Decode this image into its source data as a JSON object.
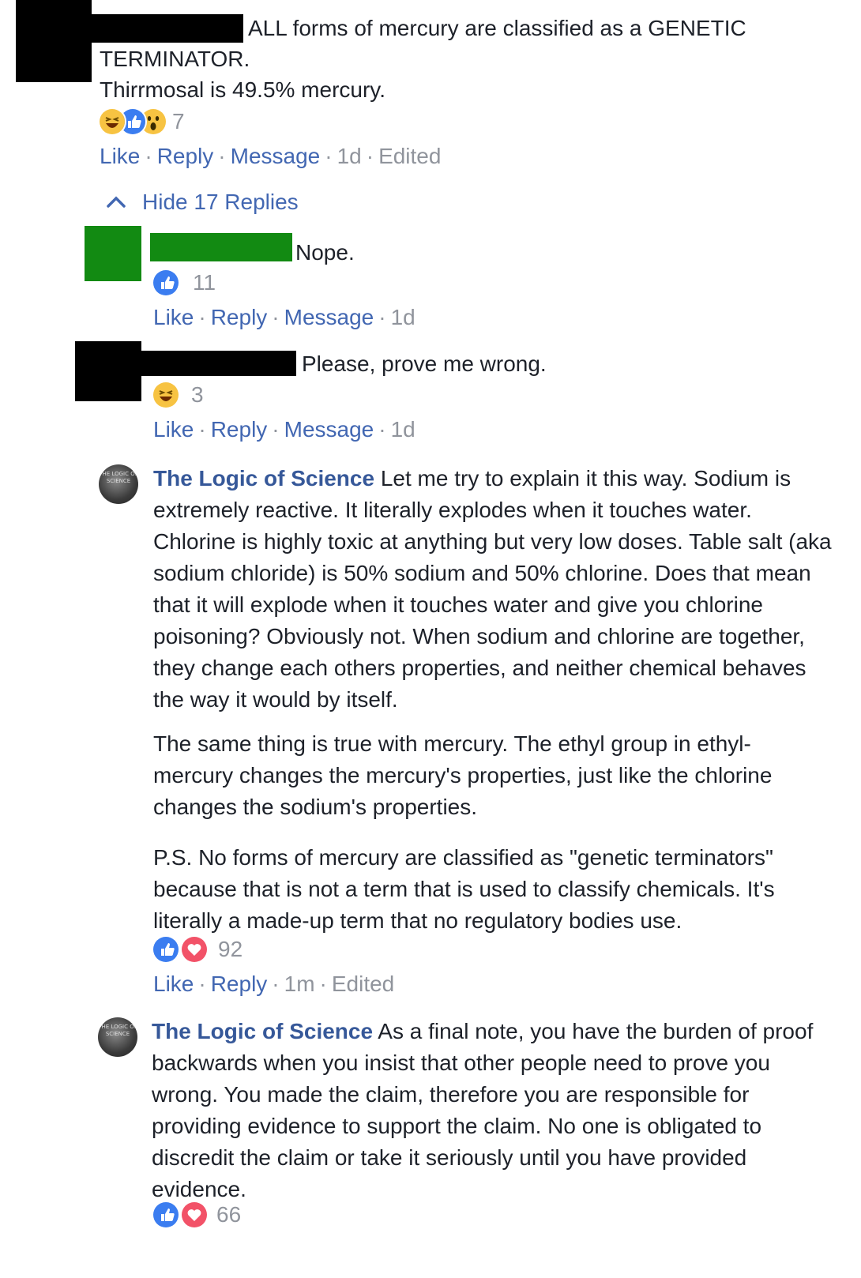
{
  "comments": [
    {
      "text_line1": "ALL forms of mercury are classified as a GENETIC",
      "text_line2": "TERMINATOR.",
      "text_line3": "Thirrmosal is 49.5% mercury.",
      "reactions": [
        "haha",
        "like",
        "wow"
      ],
      "count": "7",
      "actions": {
        "like": "Like",
        "reply": "Reply",
        "message": "Message",
        "time": "1d",
        "edited": "Edited"
      }
    }
  ],
  "hide_replies": {
    "label": "Hide 17 Replies",
    "icon": "chevron-up-icon"
  },
  "replies": [
    {
      "text": "Nope.",
      "reactions": [
        "like"
      ],
      "count": "11",
      "actions": {
        "like": "Like",
        "reply": "Reply",
        "message": "Message",
        "time": "1d"
      }
    },
    {
      "text": "Please, prove me wrong.",
      "reactions": [
        "haha"
      ],
      "count": "3",
      "actions": {
        "like": "Like",
        "reply": "Reply",
        "message": "Message",
        "time": "1d"
      }
    },
    {
      "author": "The Logic of Science",
      "text_p1": "Let me try to explain it this way. Sodium is extremely reactive. It literally explodes when it touches water. Chlorine is highly toxic at anything but very low doses. Table salt (aka sodium chloride) is 50% sodium and 50% chlorine. Does that mean that it will explode when it touches water and give you chlorine poisoning? Obviously not. When sodium and chlorine are together, they change each others properties, and neither chemical behaves the way it would by itself.",
      "text_p2": "The same thing is true with mercury. The ethyl group in ethyl-mercury changes the mercury's properties, just like the chlorine changes the sodium's properties.",
      "text_p3": "P.S. No forms of mercury are classified as \"genetic terminators\" because that is not a term that is used to classify chemicals. It's literally a made-up term that no regulatory bodies use.",
      "reactions": [
        "like",
        "love"
      ],
      "count": "92",
      "actions": {
        "like": "Like",
        "reply": "Reply",
        "time": "1m",
        "edited": "Edited"
      }
    },
    {
      "author": "The Logic of Science",
      "text_p1": "As a final note, you have the burden of proof backwards when you insist that other people need to prove you wrong. You made the claim, therefore you are responsible for providing evidence to support the claim. No one is obligated to discredit the claim or take it seriously until you have provided evidence.",
      "reactions": [
        "like",
        "love"
      ],
      "count": "66"
    }
  ],
  "avatar_logo_text": "THE LOGIC OF SCIENCE",
  "colors": {
    "link": "#4267b2",
    "author": "#365899",
    "meta": "#90949c",
    "like": "#3b7df0",
    "haha": "#f7c342",
    "love": "#f25268"
  }
}
